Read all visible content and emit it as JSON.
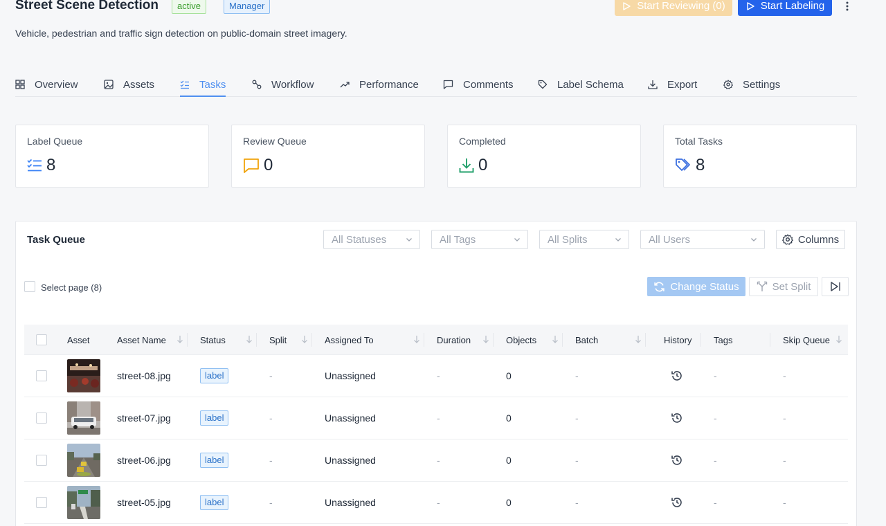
{
  "header": {
    "title": "Street Scene Detection",
    "status_badge": "active",
    "role_badge": "Manager",
    "subtitle": "Vehicle, pedestrian and traffic sign detection on public-domain street imagery.",
    "start_reviewing_label": "Start Reviewing (0)",
    "start_labeling_label": "Start Labeling"
  },
  "tabs": [
    {
      "label": "Overview",
      "icon": "grid-icon"
    },
    {
      "label": "Assets",
      "icon": "image-icon"
    },
    {
      "label": "Tasks",
      "icon": "checklist-icon",
      "active": true
    },
    {
      "label": "Workflow",
      "icon": "workflow-icon"
    },
    {
      "label": "Performance",
      "icon": "trend-icon"
    },
    {
      "label": "Comments",
      "icon": "comment-icon"
    },
    {
      "label": "Label Schema",
      "icon": "tag-icon"
    },
    {
      "label": "Export",
      "icon": "download-icon"
    },
    {
      "label": "Settings",
      "icon": "gear-icon"
    }
  ],
  "stats": [
    {
      "label": "Label Queue",
      "value": "8",
      "icon": "checklist-icon",
      "color": "#3b82f6"
    },
    {
      "label": "Review Queue",
      "value": "0",
      "icon": "comment-icon",
      "color": "#f0a30a"
    },
    {
      "label": "Completed",
      "value": "0",
      "icon": "download-icon",
      "color": "#22a06b"
    },
    {
      "label": "Total Tasks",
      "value": "8",
      "icon": "tags-icon",
      "color": "#3b6fe0"
    }
  ],
  "queue": {
    "title": "Task Queue",
    "filters": {
      "status_placeholder": "All Statuses",
      "tags_placeholder": "All Tags",
      "splits_placeholder": "All Splits",
      "users_placeholder": "All Users"
    },
    "columns_label": "Columns",
    "select_page_label": "Select page (8)",
    "change_status_label": "Change Status",
    "set_split_label": "Set Split"
  },
  "table": {
    "headers": {
      "asset": "Asset",
      "asset_name": "Asset Name",
      "status": "Status",
      "split": "Split",
      "assigned_to": "Assigned To",
      "duration": "Duration",
      "objects": "Objects",
      "batch": "Batch",
      "history": "History",
      "tags": "Tags",
      "skip_queue": "Skip Queue"
    },
    "rows": [
      {
        "name": "street-08.jpg",
        "status": "label",
        "split": "-",
        "assigned": "Unassigned",
        "duration": "-",
        "objects": "0",
        "batch": "-",
        "tags": "-",
        "skip": "-"
      },
      {
        "name": "street-07.jpg",
        "status": "label",
        "split": "-",
        "assigned": "Unassigned",
        "duration": "-",
        "objects": "0",
        "batch": "-",
        "tags": "-",
        "skip": "-"
      },
      {
        "name": "street-06.jpg",
        "status": "label",
        "split": "-",
        "assigned": "Unassigned",
        "duration": "-",
        "objects": "0",
        "batch": "-",
        "tags": "-",
        "skip": "-"
      },
      {
        "name": "street-05.jpg",
        "status": "label",
        "split": "-",
        "assigned": "Unassigned",
        "duration": "-",
        "objects": "0",
        "batch": "-",
        "tags": "-",
        "skip": "-"
      }
    ]
  }
}
